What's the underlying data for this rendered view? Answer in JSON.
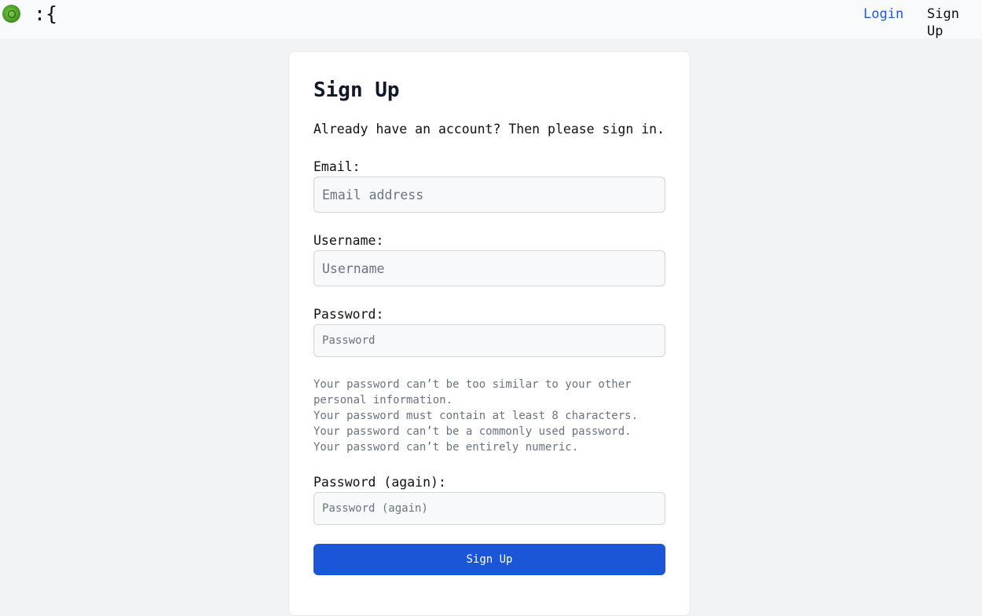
{
  "header": {
    "brand": ":{",
    "logo_icon": "green-circle-logo",
    "nav": {
      "login_label": "Login",
      "signup_label": "Sign Up"
    },
    "colors": {
      "link_accent": "#1d5bd8"
    }
  },
  "form": {
    "title": "Sign Up",
    "intro": "Already have an account? Then please sign in.",
    "email": {
      "label": "Email:",
      "placeholder": "Email address",
      "value": ""
    },
    "username": {
      "label": "Username:",
      "placeholder": "Username",
      "value": ""
    },
    "password": {
      "label": "Password:",
      "placeholder": "Password",
      "value": ""
    },
    "password_help": [
      "Your password can’t be too similar to your other personal information.",
      "Your password must contain at least 8 characters.",
      "Your password can’t be a commonly used password.",
      "Your password can’t be entirely numeric."
    ],
    "password2": {
      "label": "Password (again):",
      "placeholder": "Password (again)",
      "value": ""
    },
    "submit_label": "Sign Up",
    "colors": {
      "submit_bg": "#1b56d9",
      "help_text": "#6b7280"
    }
  }
}
